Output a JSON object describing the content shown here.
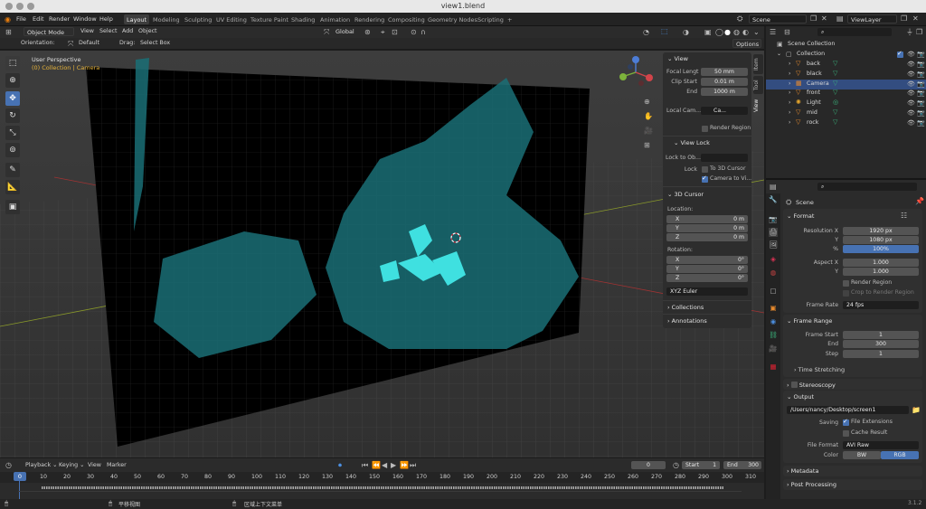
{
  "window": {
    "title": "view1.blend"
  },
  "menu": {
    "items": [
      "File",
      "Edit",
      "Render",
      "Window",
      "Help"
    ]
  },
  "workspaces": [
    "Layout",
    "Modeling",
    "Sculpting",
    "UV Editing",
    "Texture Paint",
    "Shading",
    "Animation",
    "Rendering",
    "Compositing",
    "Geometry Nodes",
    "Scripting"
  ],
  "workspace_add": "+",
  "scene": {
    "label": "Scene",
    "viewlayer": "ViewLayer"
  },
  "viewport_header": {
    "mode": "Object Mode",
    "menus": [
      "View",
      "Select",
      "Add",
      "Object"
    ],
    "orientation": "Global",
    "options": "Options"
  },
  "tool_settings": {
    "orientation_label": "Orientation:",
    "orientation_value": "Default",
    "drag_label": "Drag:",
    "drag_value": "Select Box"
  },
  "viewport": {
    "perspective": "User Perspective",
    "collection_info": "(0) Collection | Camera"
  },
  "npanel": {
    "tabs": [
      "Item",
      "Tool",
      "View"
    ],
    "view_title": "View",
    "focal_label": "Focal Lengt",
    "focal_value": "50 mm",
    "clip_start_label": "Clip Start",
    "clip_start_value": "0.01 m",
    "clip_end_label": "End",
    "clip_end_value": "1000 m",
    "local_cam_label": "Local Cam...",
    "local_cam_value": "Ca...",
    "render_region": "Render Region",
    "view_lock_title": "View Lock",
    "lock_to_obj_label": "Lock to Ob...",
    "lock_label": "Lock",
    "to_3d_cursor": "To 3D Cursor",
    "camera_to_view": "Camera to Vi...",
    "cursor_title": "3D Cursor",
    "location_label": "Location:",
    "loc_x": "0 m",
    "loc_y": "0 m",
    "loc_z": "0 m",
    "rotation_label": "Rotation:",
    "rot_x": "0°",
    "rot_y": "0°",
    "rot_z": "0°",
    "axis_x": "X",
    "axis_y": "Y",
    "axis_z": "Z",
    "rotation_mode": "XYZ Euler",
    "collections": "Collections",
    "annotations": "Annotations"
  },
  "outliner": {
    "root": "Scene Collection",
    "collection": "Collection",
    "objects": [
      "back",
      "black",
      "Camera",
      "front",
      "Light",
      "mid",
      "rock"
    ]
  },
  "properties": {
    "context": "Scene",
    "format_title": "Format",
    "res_x_label": "Resolution X",
    "res_x": "1920 px",
    "res_y_label": "Y",
    "res_y": "1080 px",
    "pct_label": "%",
    "pct": "100%",
    "aspect_x_label": "Aspect X",
    "aspect_x": "1.000",
    "aspect_y_label": "Y",
    "aspect_y": "1.000",
    "render_region": "Render Region",
    "crop_region": "Crop to Render Region",
    "frame_rate_label": "Frame Rate",
    "frame_rate": "24 fps",
    "frame_range_title": "Frame Range",
    "frame_start_label": "Frame Start",
    "frame_start": "1",
    "frame_end_label": "End",
    "frame_end": "300",
    "step_label": "Step",
    "step": "1",
    "time_stretching": "Time Stretching",
    "stereoscopy": "Stereoscopy",
    "output_title": "Output",
    "output_path": "/Users/nancy/Desktop/screen1",
    "saving_label": "Saving",
    "file_extensions": "File Extensions",
    "cache_result": "Cache Result",
    "file_format_label": "File Format",
    "file_format": "AVI Raw",
    "color_label": "Color",
    "color_bw": "BW",
    "color_rgb": "RGB",
    "metadata": "Metadata",
    "post_processing": "Post Processing"
  },
  "timeline": {
    "menus": [
      "Playback",
      "Keying",
      "View",
      "Marker"
    ],
    "current_frame": "0",
    "start_label": "Start",
    "start": "1",
    "end_label": "End",
    "end": "300",
    "ticks": [
      "0",
      "10",
      "20",
      "30",
      "40",
      "50",
      "60",
      "70",
      "80",
      "90",
      "100",
      "110",
      "120",
      "130",
      "140",
      "150",
      "160",
      "170",
      "180",
      "190",
      "200",
      "210",
      "220",
      "230",
      "240",
      "250",
      "260",
      "270",
      "280",
      "290",
      "300",
      "310"
    ],
    "playhead": "0"
  },
  "statusbar": {
    "hint1": "平移视图",
    "hint2": "区域上下文菜单",
    "version": "3.1.2"
  },
  "colors": {
    "accent": "#4772b3",
    "selected_row": "#334d80",
    "teal": "#1fb5b5"
  }
}
